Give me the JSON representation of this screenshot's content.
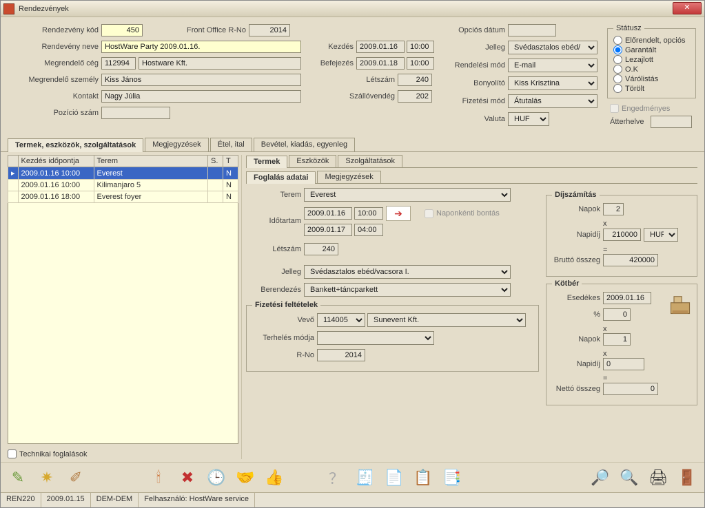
{
  "window": {
    "title": "Rendezvények"
  },
  "header": {
    "labels": {
      "event_code": "Rendezvény kód",
      "front_office": "Front Office R-No",
      "event_name": "Rendevény neve",
      "customer_company": "Megrendelő cég",
      "customer_person": "Megrendelő személy",
      "contact": "Kontakt",
      "position_no": "Pozíció szám",
      "start": "Kezdés",
      "end": "Befejezés",
      "headcount": "Létszám",
      "hotel_guest": "Szállóvendég",
      "option_date": "Opciós dátum",
      "type": "Jelleg",
      "order_mode": "Rendelési mód",
      "organizer": "Bonyolító",
      "payment_mode": "Fizetési mód",
      "currency": "Valuta",
      "discounted": "Engedményes",
      "relocated": "Átterhelve"
    },
    "values": {
      "event_code": "450",
      "front_office": "2014",
      "event_name": "HostWare Party 2009.01.16.",
      "customer_company_code": "112994",
      "customer_company_name": "Hostware Kft.",
      "customer_person": "Kiss János",
      "contact": "Nagy Júlia",
      "position_no": "",
      "start_date": "2009.01.16",
      "start_time": "10:00",
      "end_date": "2009.01.18",
      "end_time": "10:00",
      "headcount": "240",
      "hotel_guest": "202",
      "option_date": "",
      "type": "Svédasztalos ebéd/",
      "order_mode": "E-mail",
      "organizer": "Kiss Krisztina",
      "payment_mode": "Átutalás",
      "currency": "HUF",
      "discounted": false,
      "relocated": ""
    }
  },
  "status": {
    "legend": "Státusz",
    "options": [
      "Előrendelt, opciós",
      "Garantált",
      "Lezajlott",
      "O.K",
      "Várólistás",
      "Törölt"
    ],
    "selected": "Garantált"
  },
  "main_tabs": [
    "Termek, eszközök, szolgáltatások",
    "Megjegyzések",
    "Étel, ital",
    "Bevétel, kiadás, egyenleg"
  ],
  "main_tab_active": 0,
  "grid": {
    "columns": [
      "Kezdés időpontja",
      "Terem",
      "S.",
      "T"
    ],
    "rows": [
      {
        "start": "2009.01.16 10:00",
        "room": "Everest",
        "s": "",
        "t": "N",
        "selected": true
      },
      {
        "start": "2009.01.16 10:00",
        "room": "Kilimanjaro 5",
        "s": "",
        "t": "N",
        "selected": false
      },
      {
        "start": "2009.01.16 18:00",
        "room": "Everest foyer",
        "s": "",
        "t": "N",
        "selected": false
      }
    ]
  },
  "technical_bookings": {
    "label": "Technikai foglalások",
    "checked": false
  },
  "sub_tabs_top": [
    "Termek",
    "Eszközök",
    "Szolgáltatások"
  ],
  "sub_tabs_top_active": 0,
  "sub_tabs_bottom": [
    "Foglalás adatai",
    "Megjegyzések"
  ],
  "sub_tabs_bottom_active": 0,
  "booking": {
    "labels": {
      "room": "Terem",
      "duration": "Időtartam",
      "daily_breakdown": "Naponkénti bontás",
      "headcount": "Létszám",
      "type": "Jelleg",
      "equipment": "Berendezés",
      "payment_terms": "Fizetési feltételek",
      "buyer": "Vevő",
      "billing_mode": "Terhelés módja",
      "rno": "R-No"
    },
    "values": {
      "room": "Everest",
      "duration_start_date": "2009.01.16",
      "duration_start_time": "10:00",
      "duration_end_date": "2009.01.17",
      "duration_end_time": "04:00",
      "daily_breakdown": false,
      "headcount": "240",
      "type": "Svédasztalos ebéd/vacsora I.",
      "equipment": "Bankett+táncparkett",
      "buyer_code": "114005",
      "buyer_name": "Sunevent Kft.",
      "billing_mode": "",
      "rno": "2014"
    }
  },
  "fee_calc": {
    "legend": "Díjszámítás",
    "labels": {
      "days": "Napok",
      "daily_rate": "Napidíj",
      "gross": "Bruttó összeg",
      "times": "x",
      "eq": "="
    },
    "values": {
      "days": "2",
      "daily_rate": "210000",
      "currency": "HUF",
      "gross": "420000"
    }
  },
  "penalty": {
    "legend": "Kötbér",
    "labels": {
      "due": "Esedékes",
      "pct": "%",
      "days": "Napok",
      "daily_rate": "Napidíj",
      "net": "Nettó összeg",
      "times": "x",
      "eq": "="
    },
    "values": {
      "due": "2009.01.16",
      "pct": "0",
      "days": "1",
      "daily_rate": "0",
      "net": "0"
    }
  },
  "statusbar": {
    "code": "REN220",
    "date": "2009.01.15",
    "env": "DEM-DEM",
    "user_label": "Felhasználó: HostWare service"
  },
  "toolbar_icons": [
    {
      "name": "pencil-icon",
      "glyph": "✎"
    },
    {
      "name": "star-icon",
      "glyph": "✷"
    },
    {
      "name": "brush-icon",
      "glyph": "✐"
    },
    {
      "name": "candle-icon",
      "glyph": "🕯"
    },
    {
      "name": "cancel-icon",
      "glyph": "✖"
    },
    {
      "name": "clock-icon",
      "glyph": "🕒"
    },
    {
      "name": "handshake-icon",
      "glyph": "🤝"
    },
    {
      "name": "thumbs-up-icon",
      "glyph": "👍"
    },
    {
      "name": "help-icon",
      "glyph": "？"
    },
    {
      "name": "cash-register-icon",
      "glyph": "🧾"
    },
    {
      "name": "document-icon",
      "glyph": "📄"
    },
    {
      "name": "clipboard-icon",
      "glyph": "📋"
    },
    {
      "name": "notes-icon",
      "glyph": "📑"
    },
    {
      "name": "zoom-search-icon",
      "glyph": "🔎"
    },
    {
      "name": "magnifier-icon",
      "glyph": "🔍"
    },
    {
      "name": "printer-icon",
      "glyph": "🖨"
    },
    {
      "name": "exit-icon",
      "glyph": "🚪"
    }
  ]
}
